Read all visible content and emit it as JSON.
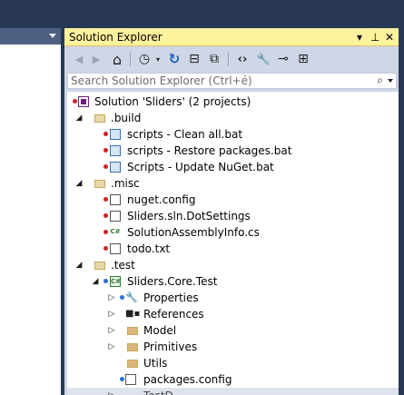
{
  "panel": {
    "title": "Solution Explorer",
    "controls": {
      "dropdown": "▾",
      "pin": "⊥",
      "close": "✕"
    }
  },
  "toolbar": {
    "buttons": [
      {
        "icon": "back-icon",
        "glyph": "◀"
      },
      {
        "icon": "forward-icon",
        "glyph": "▶"
      },
      {
        "icon": "home-icon",
        "glyph": "⌂"
      },
      {
        "icon": "pending-changes-filter-icon",
        "glyph": "◷"
      },
      {
        "icon": "refresh-icon",
        "glyph": "↻"
      },
      {
        "icon": "collapse-all-icon",
        "glyph": "⊟"
      },
      {
        "icon": "show-all-files-icon",
        "glyph": "⧉"
      },
      {
        "icon": "view-code-icon",
        "glyph": "‹›"
      },
      {
        "icon": "properties-wrench-icon",
        "glyph": "🔧"
      },
      {
        "icon": "preview-selected-icon",
        "glyph": "⊸"
      },
      {
        "icon": "class-diagram-icon",
        "glyph": "⊞"
      }
    ]
  },
  "search": {
    "placeholder": "Search Solution Explorer (Ctrl+é)",
    "icon": "search-icon"
  },
  "tree": {
    "solution": "Solution 'Sliders' (2 projects)",
    "build_folder": ".build",
    "build_items": [
      "scripts - Clean all.bat",
      "scripts - Restore packages.bat",
      "Scripts - Update NuGet.bat"
    ],
    "misc_folder": ".misc",
    "misc_items": [
      "nuget.config",
      "Sliders.sln.DotSettings",
      "SolutionAssemblyInfo.cs",
      "todo.txt"
    ],
    "test_folder": ".test",
    "project": "Sliders.Core.Test",
    "project_items": [
      "Properties",
      "References",
      "Model",
      "Primitives",
      "Utils",
      "packages.config"
    ],
    "cut_off_item": "TestD..."
  }
}
